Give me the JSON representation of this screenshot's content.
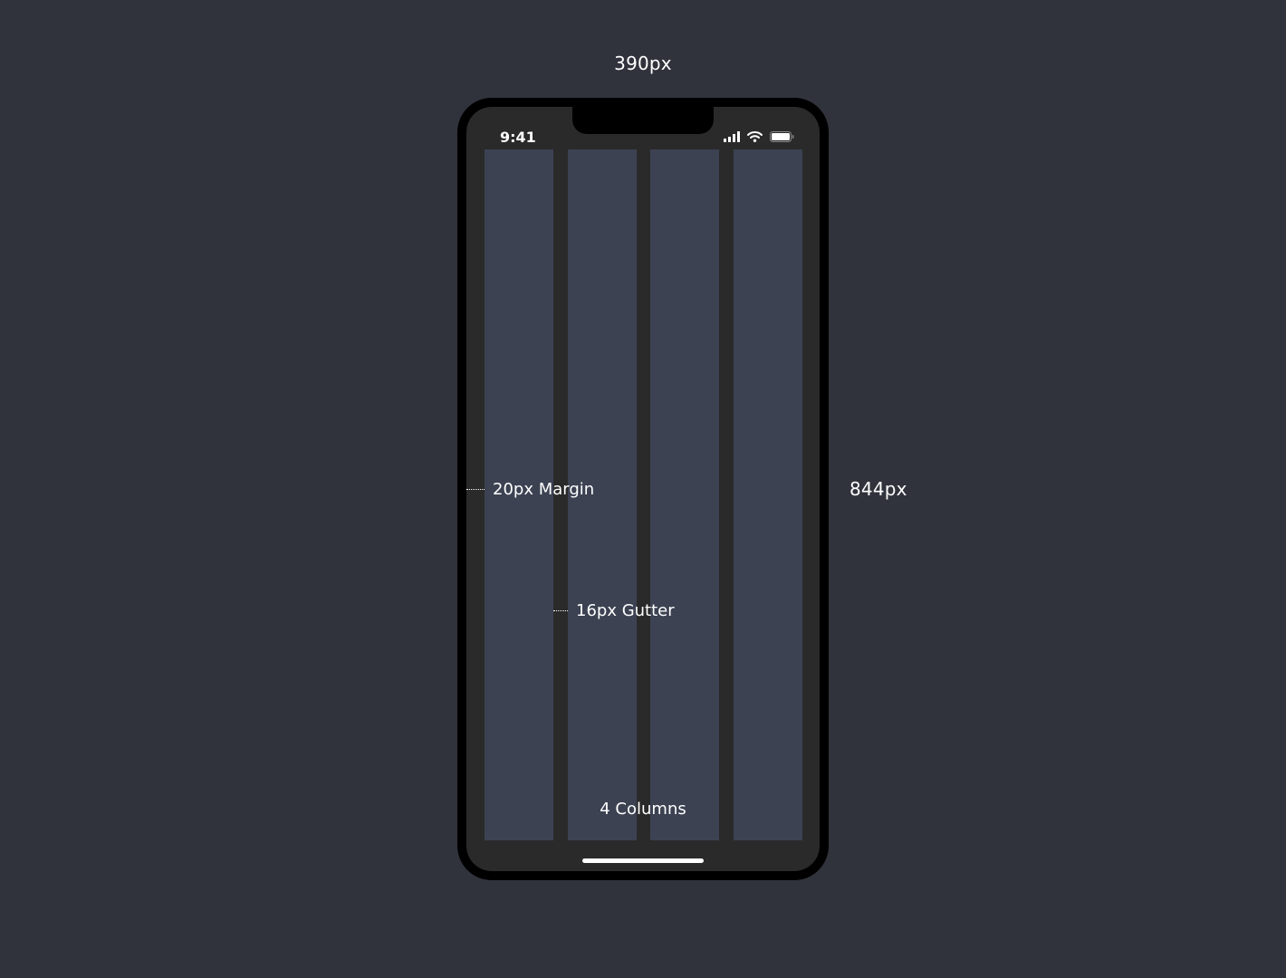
{
  "dimensions": {
    "width_label": "390px",
    "height_label": "844px"
  },
  "status_bar": {
    "time": "9:41",
    "icons": [
      "cellular-signal-icon",
      "wifi-icon",
      "battery-icon"
    ]
  },
  "grid": {
    "column_count": 4,
    "margin_label": "20px Margin",
    "gutter_label": "16px Gutter",
    "columns_label": "4 Columns"
  },
  "colors": {
    "background": "#31333c",
    "device_frame": "#000000",
    "screen": "#2a2a2b",
    "column": "#3c4252",
    "text": "#ffffff"
  }
}
